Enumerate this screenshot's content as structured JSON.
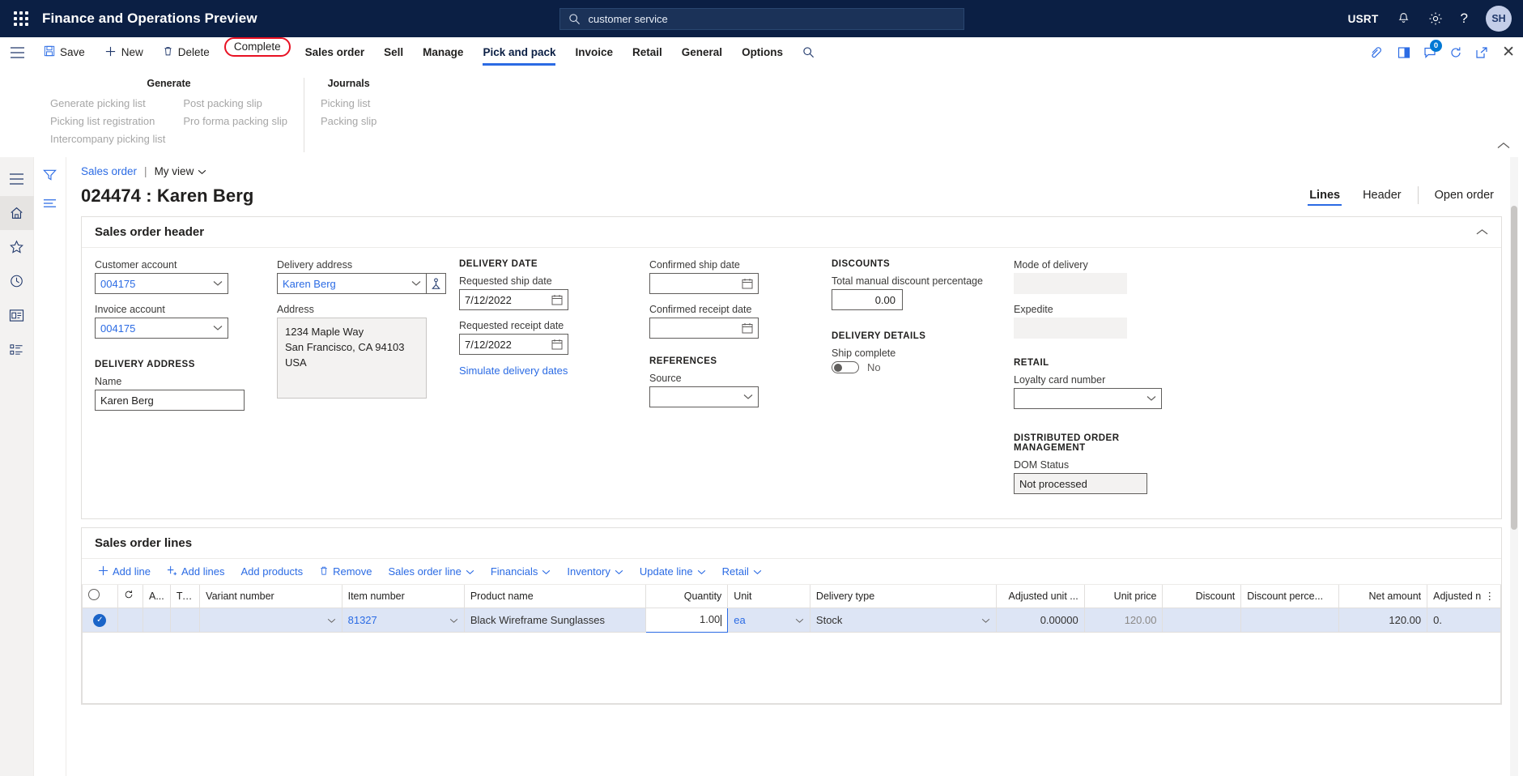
{
  "topbar": {
    "app_title": "Finance and Operations Preview",
    "search_value": "customer service",
    "company": "USRT",
    "avatar_initials": "SH",
    "icons": {
      "waffle": "app-launcher-icon",
      "search": "search-icon",
      "bell": "notifications-icon",
      "gear": "settings-icon",
      "help": "help-icon"
    }
  },
  "commandbar": {
    "items": [
      {
        "label": "Save",
        "icon": "save-icon",
        "name": "save-button"
      },
      {
        "label": "New",
        "icon": "plus-icon",
        "name": "new-button"
      },
      {
        "label": "Delete",
        "icon": "trash-icon",
        "name": "delete-button"
      },
      {
        "label": "Complete",
        "icon": "",
        "name": "complete-button"
      },
      {
        "label": "Sales order",
        "icon": "",
        "name": "tab-sales-order"
      },
      {
        "label": "Sell",
        "icon": "",
        "name": "tab-sell"
      },
      {
        "label": "Manage",
        "icon": "",
        "name": "tab-manage"
      },
      {
        "label": "Pick and pack",
        "icon": "",
        "name": "tab-pick-and-pack"
      },
      {
        "label": "Invoice",
        "icon": "",
        "name": "tab-invoice"
      },
      {
        "label": "Retail",
        "icon": "",
        "name": "tab-retail"
      },
      {
        "label": "General",
        "icon": "",
        "name": "tab-general"
      },
      {
        "label": "Options",
        "icon": "",
        "name": "tab-options"
      }
    ],
    "notification_count": "0"
  },
  "action_pane": {
    "groups": [
      {
        "title": "Generate",
        "columns": [
          [
            "Generate picking list",
            "Picking list registration",
            "Intercompany picking list"
          ],
          [
            "Post packing slip",
            "Pro forma packing slip"
          ]
        ]
      },
      {
        "title": "Journals",
        "columns": [
          [
            "Picking list",
            "Packing slip"
          ]
        ]
      }
    ]
  },
  "leftnav": {
    "items": [
      {
        "name": "menu-icon",
        "label": "Menu"
      },
      {
        "name": "home-icon",
        "label": "Home"
      },
      {
        "name": "favorites-star-icon",
        "label": "Favorites"
      },
      {
        "name": "recent-clock-icon",
        "label": "Recent"
      },
      {
        "name": "workspaces-icon",
        "label": "Workspaces"
      },
      {
        "name": "modules-list-icon",
        "label": "Modules"
      }
    ]
  },
  "breadcrumb": {
    "root": "Sales order",
    "separator": "|",
    "view": "My view"
  },
  "page": {
    "title": "024474 : Karen Berg",
    "tabs": [
      {
        "label": "Lines",
        "selected": true
      },
      {
        "label": "Header",
        "selected": false
      },
      {
        "label": "Open order",
        "selected": false
      }
    ]
  },
  "header_fasttab": {
    "title": "Sales order header",
    "customer_account": {
      "label": "Customer account",
      "value": "004175"
    },
    "invoice_account": {
      "label": "Invoice account",
      "value": "004175"
    },
    "delivery_address_section": "DELIVERY ADDRESS",
    "name": {
      "label": "Name",
      "value": "Karen Berg"
    },
    "delivery_address": {
      "label": "Delivery address",
      "value": "Karen Berg"
    },
    "address": {
      "label": "Address",
      "value": "1234 Maple Way\nSan Francisco, CA 94103\nUSA"
    },
    "delivery_date_section": "DELIVERY DATE",
    "requested_ship_date": {
      "label": "Requested ship date",
      "value": "7/12/2022"
    },
    "requested_receipt_date": {
      "label": "Requested receipt date",
      "value": "7/12/2022"
    },
    "simulate_link": "Simulate delivery dates",
    "confirmed_ship_date": {
      "label": "Confirmed ship date",
      "value": ""
    },
    "confirmed_receipt_date": {
      "label": "Confirmed receipt date",
      "value": ""
    },
    "references_section": "REFERENCES",
    "source": {
      "label": "Source",
      "value": ""
    },
    "discounts_section": "DISCOUNTS",
    "total_manual_discount_percentage": {
      "label": "Total manual discount percentage",
      "value": "0.00"
    },
    "delivery_details_section": "DELIVERY DETAILS",
    "ship_complete": {
      "label": "Ship complete",
      "value": "No"
    },
    "mode_of_delivery": {
      "label": "Mode of delivery",
      "value": ""
    },
    "expedite": {
      "label": "Expedite",
      "value": ""
    },
    "retail_section": "RETAIL",
    "loyalty_card_number": {
      "label": "Loyalty card number",
      "value": ""
    },
    "dom_section": "DISTRIBUTED ORDER MANAGEMENT",
    "dom_status": {
      "label": "DOM Status",
      "value": "Not processed"
    }
  },
  "lines_fasttab": {
    "title": "Sales order lines",
    "toolbar": [
      {
        "label": "Add line",
        "icon": "plus-icon",
        "name": "add-line-button"
      },
      {
        "label": "Add lines",
        "icon": "plus-lines-icon",
        "name": "add-lines-button"
      },
      {
        "label": "Add products",
        "icon": "",
        "name": "add-products-button"
      },
      {
        "label": "Remove",
        "icon": "trash-icon",
        "name": "remove-line-button"
      },
      {
        "label": "Sales order line",
        "icon": "chevron-down-icon",
        "name": "sales-order-line-menu"
      },
      {
        "label": "Financials",
        "icon": "chevron-down-icon",
        "name": "financials-menu"
      },
      {
        "label": "Inventory",
        "icon": "chevron-down-icon",
        "name": "inventory-menu"
      },
      {
        "label": "Update line",
        "icon": "chevron-down-icon",
        "name": "update-line-menu"
      },
      {
        "label": "Retail",
        "icon": "chevron-down-icon",
        "name": "retail-menu"
      }
    ],
    "columns": [
      {
        "label": "",
        "key": "select",
        "align": "center"
      },
      {
        "label": "",
        "key": "refresh",
        "align": "center"
      },
      {
        "label": "A...",
        "key": "a",
        "align": "left"
      },
      {
        "label": "Ty...",
        "key": "ty",
        "align": "left"
      },
      {
        "label": "Variant number",
        "key": "variant_number",
        "align": "left"
      },
      {
        "label": "Item number",
        "key": "item_number",
        "align": "left"
      },
      {
        "label": "Product name",
        "key": "product_name",
        "align": "left"
      },
      {
        "label": "Quantity",
        "key": "quantity",
        "align": "right"
      },
      {
        "label": "Unit",
        "key": "unit",
        "align": "left"
      },
      {
        "label": "Delivery type",
        "key": "delivery_type",
        "align": "left"
      },
      {
        "label": "Adjusted unit ...",
        "key": "adjusted_unit",
        "align": "right"
      },
      {
        "label": "Unit price",
        "key": "unit_price",
        "align": "right"
      },
      {
        "label": "Discount",
        "key": "discount",
        "align": "right"
      },
      {
        "label": "Discount perce...",
        "key": "discount_percent",
        "align": "left"
      },
      {
        "label": "Net amount",
        "key": "net_amount",
        "align": "right"
      },
      {
        "label": "Adjusted n",
        "key": "adjusted_net",
        "align": "left"
      }
    ],
    "rows": [
      {
        "selected": true,
        "variant_number": "",
        "item_number": "81327",
        "product_name": "Black Wireframe Sunglasses",
        "quantity": "1.00",
        "unit": "ea",
        "delivery_type": "Stock",
        "adjusted_unit": "0.00000",
        "unit_price": "120.00",
        "discount": "",
        "discount_percent": "",
        "net_amount": "120.00",
        "adjusted_net": "0."
      }
    ]
  },
  "colors": {
    "nav_background": "#0b1f44",
    "accent_blue": "#2b6be4",
    "highlight_red": "#e81123",
    "row_selected": "#dde5f5"
  }
}
